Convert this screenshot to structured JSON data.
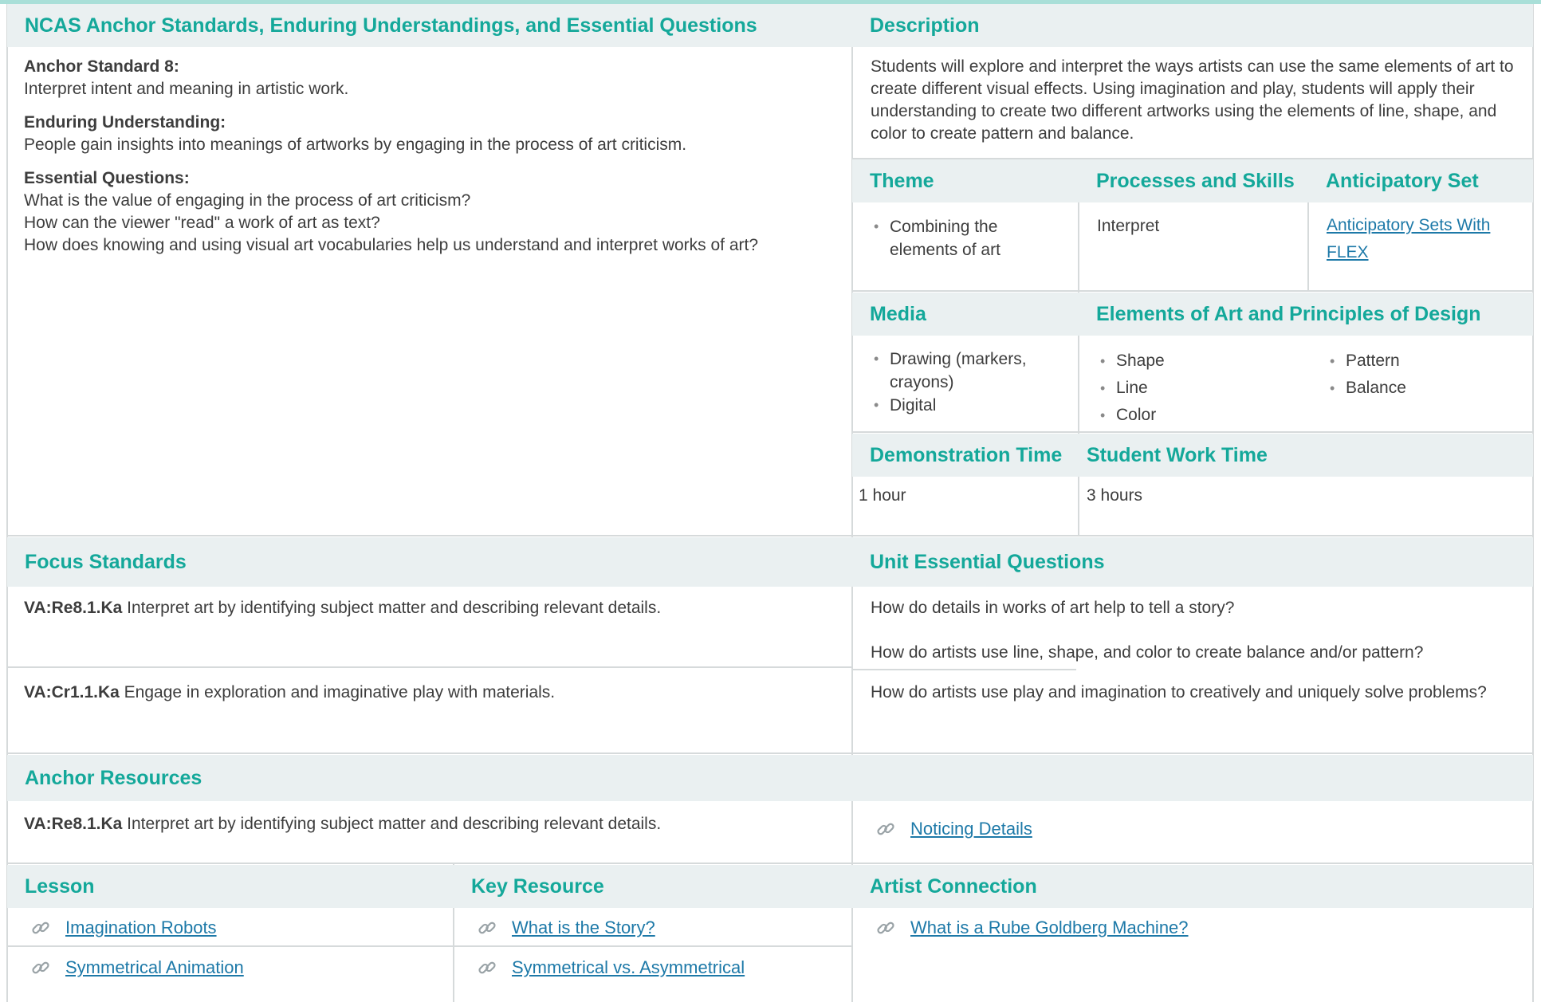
{
  "ncas": {
    "header": "NCAS Anchor Standards, Enduring Understandings, and Essential Questions",
    "anchor_standard_label": "Anchor Standard 8:",
    "anchor_standard_text": "Interpret intent and meaning in artistic work.",
    "enduring_label": "Enduring Understanding:",
    "enduring_text": "People gain insights into meanings of artworks by engaging in the process of art criticism.",
    "essential_label": "Essential Questions:",
    "essential_questions": [
      "What is the value of engaging in the process of art criticism?",
      "How can the viewer \"read\" a work of art as text?",
      "How does knowing and using visual art vocabularies help us understand and interpret works of art?"
    ]
  },
  "description": {
    "header": "Description",
    "text": "Students will explore and interpret the ways artists can use the same elements of art to create different visual effects. Using imagination and play, students will apply their understanding to create two different artworks using the elements of line, shape, and color to create pattern and balance."
  },
  "theme": {
    "header": "Theme",
    "items": [
      "Combining the elements of art"
    ]
  },
  "processes": {
    "header": "Processes and Skills",
    "text": "Interpret"
  },
  "anticipatory": {
    "header": "Anticipatory Set",
    "link": "Anticipatory Sets With FLEX"
  },
  "media": {
    "header": "Media",
    "items": [
      "Drawing (markers, crayons)",
      "Digital"
    ]
  },
  "elements": {
    "header": "Elements of Art and Principles of Design",
    "col1": [
      "Shape",
      "Line",
      "Color"
    ],
    "col2": [
      "Pattern",
      "Balance"
    ]
  },
  "demo_time": {
    "header": "Demonstration Time",
    "value": "1 hour"
  },
  "work_time": {
    "header": "Student Work Time",
    "value": "3 hours"
  },
  "focus": {
    "header": "Focus Standards",
    "items": [
      {
        "code": "VA:Re8.1.Ka",
        "text": " Interpret art by identifying subject matter and describing relevant details."
      },
      {
        "code": "VA:Cr1.1.Ka",
        "text": " Engage in exploration and imaginative play with materials."
      }
    ]
  },
  "unit_eq": {
    "header": "Unit Essential Questions",
    "items": [
      "How do details in works of art help to tell a story?",
      "How do artists use line, shape, and color to create balance and/or pattern?",
      "How do artists use play and imagination to creatively and uniquely solve problems?"
    ]
  },
  "anchor_resources": {
    "header": "Anchor Resources",
    "code": "VA:Re8.1.Ka",
    "text": " Interpret art by identifying subject matter and describing relevant details.",
    "link": "Noticing Details"
  },
  "lesson": {
    "header": "Lesson",
    "links": [
      "Imagination Robots",
      "Symmetrical Animation"
    ]
  },
  "key_resource": {
    "header": "Key Resource",
    "links": [
      "What is the Story?",
      "Symmetrical vs. Asymmetrical"
    ]
  },
  "artist_connection": {
    "header": "Artist Connection",
    "links": [
      "What is a Rube Goldberg Machine?"
    ]
  },
  "colors": {
    "accent": "#14a89a",
    "header_bg": "#eaf0f1",
    "link": "#1d79a8",
    "border": "#d6dadb"
  }
}
